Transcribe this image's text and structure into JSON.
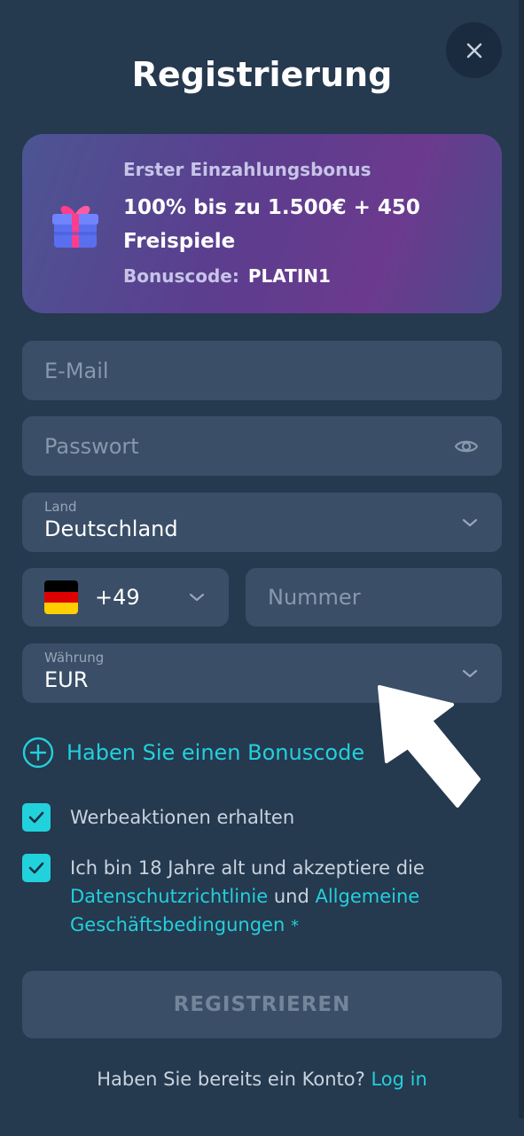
{
  "header": {
    "title": "Registrierung",
    "close_icon": "close-icon"
  },
  "bonus": {
    "subtitle": "Erster Einzahlungsbonus",
    "headline": "100% bis zu 1.500€ + 450 Freispiele",
    "code_label": "Bonuscode:",
    "code_value": "PLATIN1",
    "icon": "gift-icon"
  },
  "form": {
    "email": {
      "placeholder": "E-Mail",
      "value": ""
    },
    "password": {
      "placeholder": "Passwort",
      "value": "",
      "icon": "eye-icon"
    },
    "country": {
      "label": "Land",
      "value": "Deutschland"
    },
    "phone": {
      "country_code": "+49",
      "flag": "germany-flag",
      "placeholder": "Nummer",
      "value": ""
    },
    "currency": {
      "label": "Währung",
      "value": "EUR"
    }
  },
  "bonus_code_link": {
    "label": "Haben Sie einen Bonuscode",
    "icon": "plus-circle-icon"
  },
  "checkboxes": {
    "promotions": {
      "label": "Werbeaktionen erhalten",
      "checked": true
    },
    "terms": {
      "checked": true,
      "text_before": "Ich bin 18 Jahre alt und akzeptiere die ",
      "privacy_link": "Datenschutzrichtlinie",
      "text_middle": " und ",
      "terms_link": "Allgemeine Geschäftsbedingungen",
      "required_mark": "*"
    }
  },
  "register_button": {
    "label": "REGISTRIEREN"
  },
  "login": {
    "text": "Haben Sie bereits ein Konto?",
    "link": "Log in"
  },
  "colors": {
    "background": "#25394f",
    "field": "#3a4e67",
    "accent": "#23d0dc",
    "bonus_gradient_start": "#4c5594",
    "bonus_gradient_mid": "#6b3a8e"
  }
}
